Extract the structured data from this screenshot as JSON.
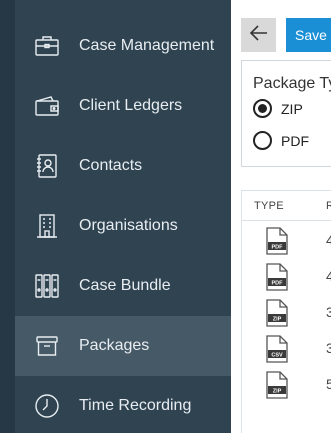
{
  "sidebar": {
    "items": [
      {
        "label": "Case Management",
        "icon": "briefcase-icon",
        "active": false
      },
      {
        "label": "Client Ledgers",
        "icon": "wallet-icon",
        "active": false
      },
      {
        "label": "Contacts",
        "icon": "contacts-book-icon",
        "active": false
      },
      {
        "label": "Organisations",
        "icon": "building-icon",
        "active": false
      },
      {
        "label": "Case Bundle",
        "icon": "binders-icon",
        "active": false
      },
      {
        "label": "Packages",
        "icon": "package-box-icon",
        "active": true
      },
      {
        "label": "Time Recording",
        "icon": "clock-icon",
        "active": false
      }
    ]
  },
  "toolbar": {
    "back_icon": "arrow-left-icon",
    "save_label": "Save"
  },
  "package_type": {
    "title": "Package Typ",
    "options": [
      {
        "label": "ZIP",
        "selected": true
      },
      {
        "label": "PDF",
        "selected": false
      }
    ]
  },
  "table": {
    "headers": [
      "TYPE",
      "R"
    ],
    "rows": [
      {
        "type": "PDF",
        "r": "4"
      },
      {
        "type": "PDF",
        "r": "4"
      },
      {
        "type": "ZIP",
        "r": "3"
      },
      {
        "type": "CSV",
        "r": "3"
      },
      {
        "type": "ZIP",
        "r": "5"
      }
    ]
  },
  "colors": {
    "sidebar_bg": "#2f4351",
    "sidebar_active": "#465966",
    "save_blue": "#1a8fd6"
  }
}
